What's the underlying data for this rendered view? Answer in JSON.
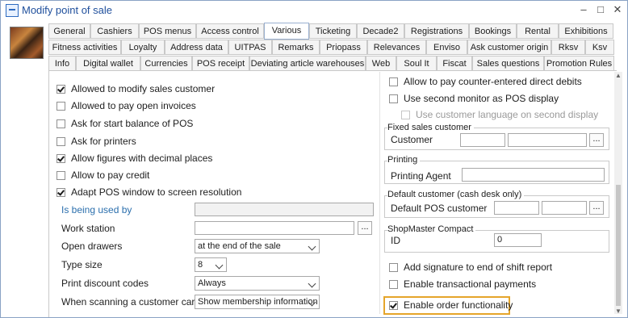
{
  "window": {
    "title": "Modify point of sale"
  },
  "window_controls": {
    "minimize": "–",
    "maximize": "□",
    "close": "✕"
  },
  "tabs": {
    "row1": [
      "General",
      "Cashiers",
      "POS menus",
      "Access control",
      "Various",
      "Ticketing",
      "Decade2",
      "Registrations",
      "Bookings",
      "Rental",
      "Exhibitions"
    ],
    "row2": [
      "Fitness activities",
      "Loyalty",
      "Address data",
      "UITPAS",
      "Remarks",
      "Priopass",
      "Relevances",
      "Enviso",
      "Ask customer origin",
      "Rksv",
      "Ksv"
    ],
    "row3": [
      "Info",
      "Digital wallet",
      "Currencies",
      "POS receipt",
      "Deviating article warehouses",
      "Web",
      "Soul It",
      "Fiscat",
      "Sales questions",
      "Promotion Rules"
    ],
    "active": "Various"
  },
  "left": {
    "checkboxes": [
      {
        "label": "Allowed to modify sales customer",
        "checked": true
      },
      {
        "label": "Allowed to pay open invoices",
        "checked": false
      },
      {
        "label": "Ask for start balance of POS",
        "checked": false
      },
      {
        "label": "Ask for printers",
        "checked": false
      },
      {
        "label": "Allow figures with decimal places",
        "checked": true
      },
      {
        "label": "Allow to pay credit",
        "checked": false
      },
      {
        "label": "Adapt POS window to screen resolution",
        "checked": true
      }
    ],
    "is_being_used_by_label": "Is being used by",
    "work_station_label": "Work station",
    "ellipsis": "...",
    "open_drawers_label": "Open drawers",
    "open_drawers_value": "at the end of the sale",
    "type_size_label": "Type size",
    "type_size_value": "8",
    "print_discount_label": "Print discount codes",
    "print_discount_value": "Always",
    "scanning_label": "When scanning a customer card",
    "scanning_value": "Show membership information"
  },
  "right": {
    "allow_direct_debits": {
      "label": "Allow to pay counter-entered direct debits",
      "checked": false
    },
    "second_monitor": {
      "label": "Use second monitor as POS display",
      "checked": false
    },
    "customer_language": {
      "label": "Use customer language on second display",
      "checked": false
    },
    "fixed_sales_customer": {
      "title": "Fixed sales customer",
      "customer_label": "Customer"
    },
    "printing": {
      "title": "Printing",
      "agent_label": "Printing Agent"
    },
    "default_customer": {
      "title": "Default customer (cash desk only)",
      "label": "Default POS customer"
    },
    "shopmaster": {
      "title": "ShopMaster Compact",
      "id_label": "ID",
      "id_value": "0"
    },
    "add_signature": {
      "label": "Add signature to end of shift report",
      "checked": false
    },
    "transactional_payments": {
      "label": "Enable transactional payments",
      "checked": false
    },
    "order_functionality": {
      "label": "Enable order functionality",
      "checked": true
    }
  },
  "colors": {
    "title": "#1f4f9c",
    "blue_label": "#2b6fad",
    "highlight": "#e5a52b"
  }
}
